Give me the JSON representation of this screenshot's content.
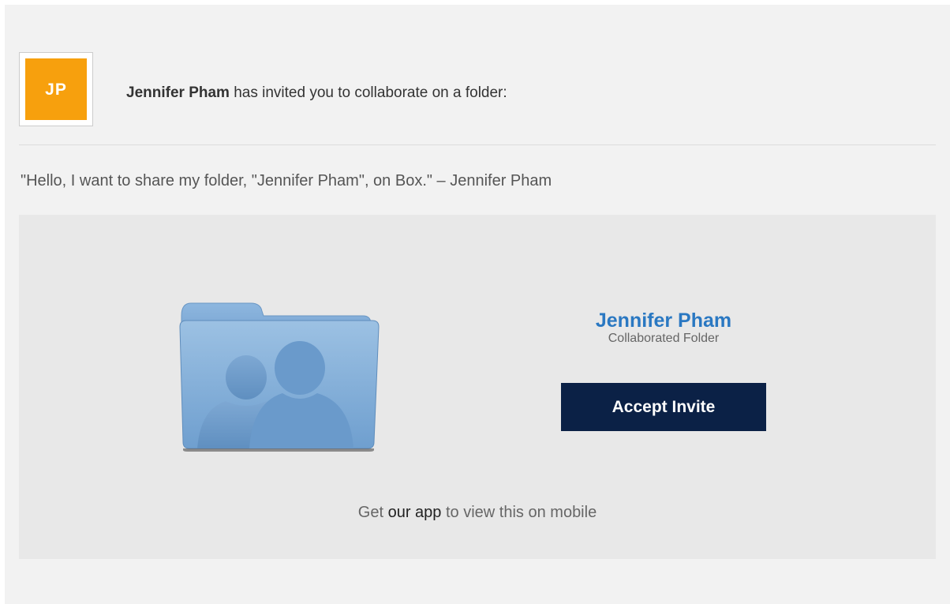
{
  "invite": {
    "avatar_initials": "JP",
    "inviter_name": "Jennifer Pham",
    "invite_text": " has invited you to collaborate on a folder:"
  },
  "message": "\"Hello, I want to share my folder, \"Jennifer Pham\", on Box.\" – Jennifer Pham",
  "folder": {
    "name": "Jennifer Pham",
    "subtitle": "Collaborated Folder",
    "accept_label": "Accept Invite"
  },
  "mobile": {
    "prefix": "Get ",
    "link_text": "our app",
    "suffix": " to view this on mobile"
  },
  "colors": {
    "avatar_bg": "#f7a00d",
    "folder_name": "#2a78c2",
    "accept_button": "#0b2146",
    "page_bg": "#f2f2f2",
    "card_bg": "#e8e8e8"
  },
  "icons": {
    "folder": "shared-folder-icon"
  }
}
